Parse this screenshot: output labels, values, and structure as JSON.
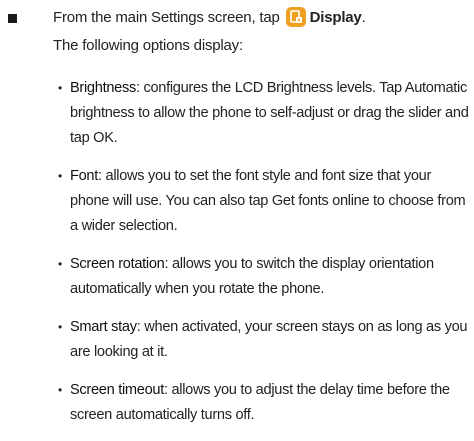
{
  "step": {
    "text_before_icon": "From the main Settings screen, tap",
    "icon": "display-settings-icon",
    "icon_color": "#f0a020",
    "target_label": "Display",
    "period": ".",
    "follow_text": "The following options display:"
  },
  "options": [
    {
      "term": "Brightness",
      "description": ": configures the LCD Brightness levels. Tap Automatic brightness to allow the phone to self-adjust or drag the slider and tap OK."
    },
    {
      "term": "Font",
      "description": ": allows you to set the font style and font size that your phone will use. You can also tap Get fonts online to choose from a wider selection."
    },
    {
      "term": "Screen rotation",
      "description": ": allows you to switch the display orientation automatically when you rotate the phone."
    },
    {
      "term": "Smart stay",
      "description": ": when activated, your screen stays on as long as you are looking at it."
    },
    {
      "term": "Screen timeout",
      "description": ": allows you to adjust the delay time before the screen automatically turns off."
    }
  ],
  "bullet_glyph": "•"
}
